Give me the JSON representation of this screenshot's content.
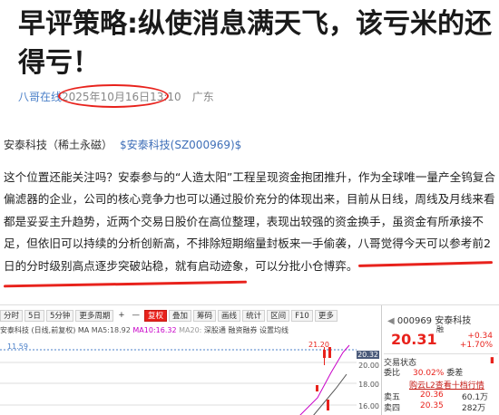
{
  "article": {
    "title": "早评策略:纵使消息满天飞，该亏米的还得亏！",
    "author": "八哥在线",
    "date": "2025年10月16日",
    "time": "13:10",
    "location": "广东",
    "stock_name": "安泰科技（稀土永磁）",
    "stock_cashtag": "$安泰科技(SZ000969)$",
    "paragraph_part1": "这个位置还能关注吗？安泰参与的“人造太阳”工程呈现资金抱团推升，作为全球唯一量产全钨复合偏滤器的企业，公司的核心竞争力也可以通过股价充分的体现出来，目前从日线，周线及月线来看都是妥妥主升趋势，近两个交易日股价在高位整理，表现出较强的资金换手，虽资金有所承接不足，但依旧可以持续的分析创新高，不排除短期缩量封板来一手偷袭，",
    "paragraph_emph": "八哥觉得今天可以参考前2日的分时级别高点逐步突破站稳，就有启动迹象",
    "paragraph_part2": "，可以分批小仓博弈。"
  },
  "app": {
    "toolbar": [
      "分时",
      "5日",
      "5分钟",
      "更多周期",
      "+",
      "—",
      "复权",
      "叠加",
      "筹码",
      "画线",
      "统计",
      "区间",
      "F10",
      "更多"
    ],
    "chart_head": {
      "stock": "安泰科技 (日线,前复权)",
      "ma": "MA",
      "ma5": "MA5:18.92",
      "ma10": "MA10:16.32",
      "ma20": "MA20:",
      "extra": "深股通  融资融券  设置均线"
    },
    "chart_labels": {
      "high": "21.20",
      "low": "11.59"
    },
    "yaxis": [
      "20.32",
      "20.00",
      "18.00",
      "16.00"
    ],
    "side": {
      "code": "000969 安泰科技",
      "badge": "融",
      "price": "20.31",
      "change": "+0.34",
      "change_pct": "+1.70%",
      "state_label": "交易状态",
      "webi_label": "委比",
      "webi_value": "30.02%",
      "webi_suffix": "委差",
      "ad_text": "购云L2查看十档行情",
      "sell5_label": "卖五",
      "sell5_price": "20.36",
      "sell5_vol": "60.1万",
      "sell4_label": "卖四",
      "sell4_price": "20.35",
      "sell4_vol": "282万"
    }
  }
}
